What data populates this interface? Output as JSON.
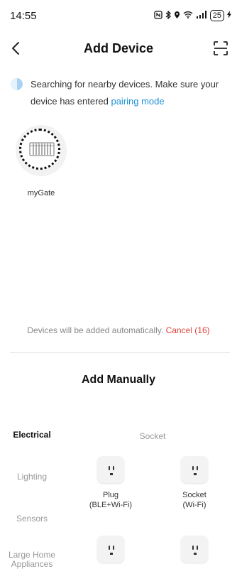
{
  "status_bar": {
    "time": "14:55",
    "icons": [
      "nfc-icon",
      "bluetooth-icon",
      "location-icon",
      "wifi-icon",
      "signal-icon"
    ],
    "battery": "25"
  },
  "header": {
    "title": "Add Device"
  },
  "searching": {
    "text": "Searching for nearby devices. Make sure your device has entered ",
    "link": "pairing mode"
  },
  "found_devices": [
    {
      "name": "myGate",
      "icon": "gate-icon"
    }
  ],
  "auto_add": {
    "text": "Devices will be added automatically. ",
    "cancel": "Cancel (16)"
  },
  "manual": {
    "title": "Add Manually",
    "categories": [
      "Electrical",
      "Lighting",
      "Sensors",
      "Large Home Appliances"
    ],
    "active_category": "Electrical",
    "section_title": "Socket",
    "devices": [
      {
        "line1": "Plug",
        "line2": "(BLE+Wi-Fi)"
      },
      {
        "line1": "Socket",
        "line2": "(Wi-Fi)"
      },
      {
        "line1": "",
        "line2": ""
      },
      {
        "line1": "",
        "line2": ""
      }
    ]
  },
  "colors": {
    "link": "#1e90d6",
    "cancel": "#e0413a",
    "muted": "#999999"
  }
}
